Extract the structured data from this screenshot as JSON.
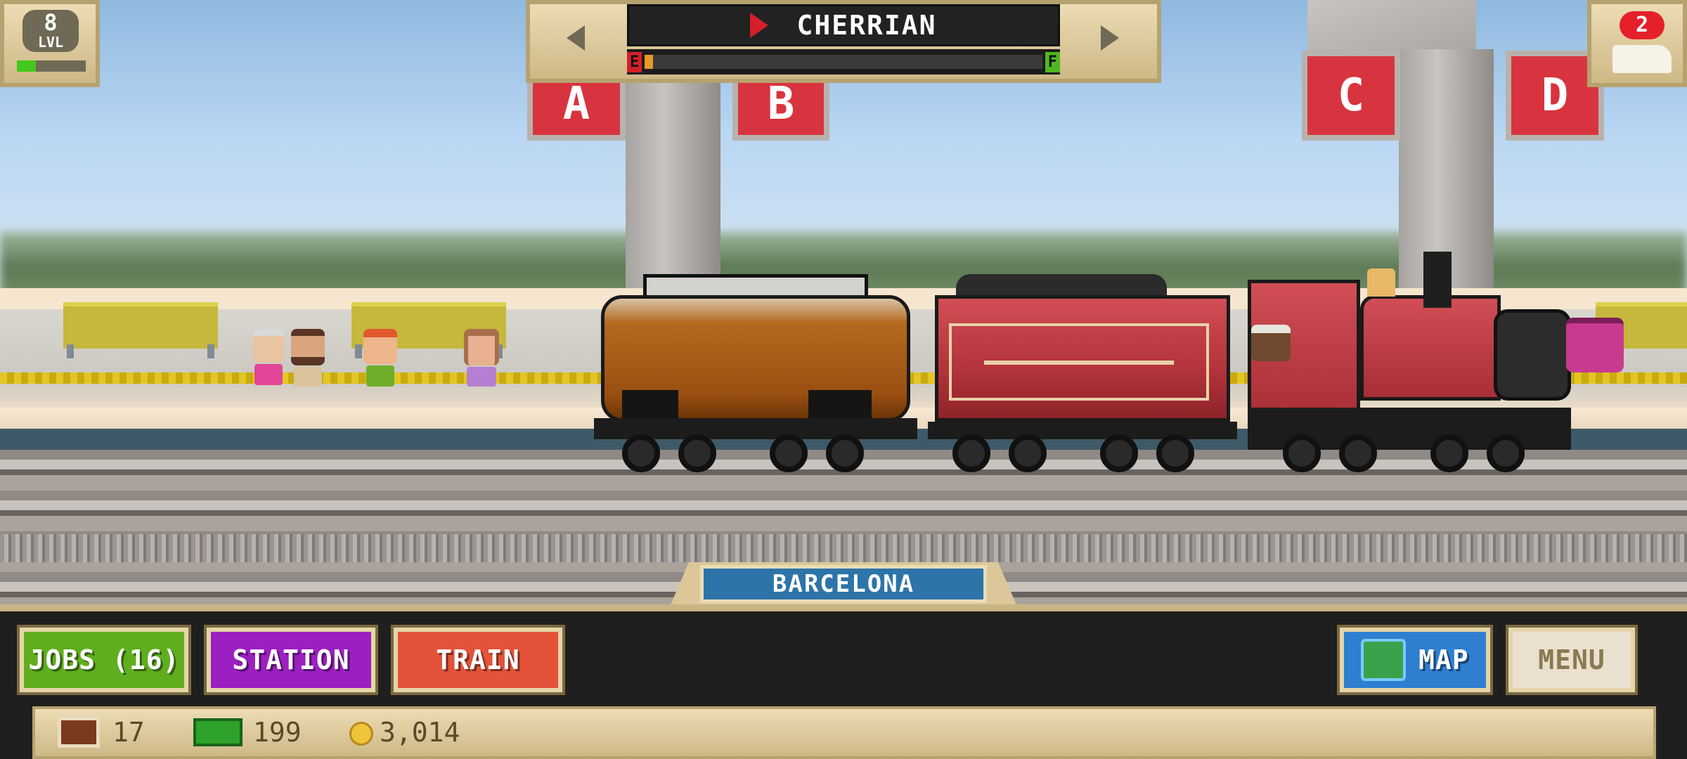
{
  "level": {
    "value": "8",
    "label": "LVL"
  },
  "notifications": {
    "count": "2"
  },
  "train_selector": {
    "name": "CHERRIAN",
    "fuel_empty": "E",
    "fuel_full": "F",
    "fuel_level": 0.02
  },
  "platform_signs": [
    "A",
    "B",
    "C",
    "D"
  ],
  "station": {
    "name": "BARCELONA"
  },
  "buttons": {
    "jobs": "JOBS (16)",
    "station": "STATION",
    "train": "TRAIN",
    "map": "MAP",
    "menu": "MENU"
  },
  "resources": {
    "tickets": "17",
    "cash": "199",
    "coins": "3,014"
  },
  "colors": {
    "jobs": "#5fae1e",
    "station": "#9c1fc2",
    "train": "#e4523a",
    "map": "#2f7fd0",
    "menu": "#e9e0cf",
    "sign": "#d8343f"
  }
}
